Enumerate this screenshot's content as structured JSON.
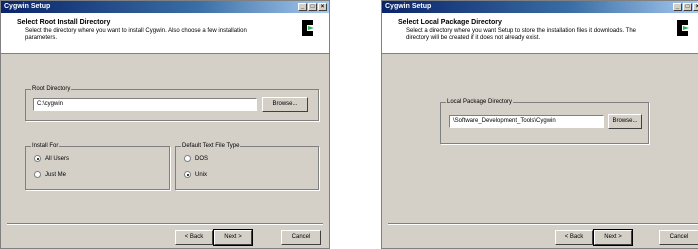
{
  "window1": {
    "title": "Cygwin Setup",
    "header_title": "Select Root Install Directory",
    "header_desc": "Select the directory where you want to install Cygwin.  Also choose a few installation parameters.",
    "root_group_label": "Root Directory",
    "root_value": "C:\\cygwin",
    "browse_label": "Browse...",
    "install_for_label": "Install For",
    "install_for_options": [
      "All Users",
      "Just Me"
    ],
    "file_type_label": "Default Text File Type",
    "file_type_options": [
      "DOS",
      "Unix"
    ],
    "back_label": "< Back",
    "next_label": "Next >",
    "cancel_label": "Cancel"
  },
  "window2": {
    "title": "Cygwin Setup",
    "header_title": "Select Local Package Directory",
    "header_desc": "Select a directory where you want Setup to store the installation files it downloads.  The directory will be created if it does not already exist.",
    "group_label": "Local Package Directory",
    "dir_value": "\\Software_Development_Tools\\Cygwin",
    "browse_label": "Browse...",
    "back_label": "< Back",
    "next_label": "Next >",
    "cancel_label": "Cancel"
  },
  "colors": {
    "titlebar_start": "#0a246a",
    "face": "#d4d0c8",
    "logo_green": "#2cb34a"
  },
  "icons": [
    "minimize-icon",
    "maximize-icon",
    "close-icon",
    "cygwin-logo-icon"
  ]
}
